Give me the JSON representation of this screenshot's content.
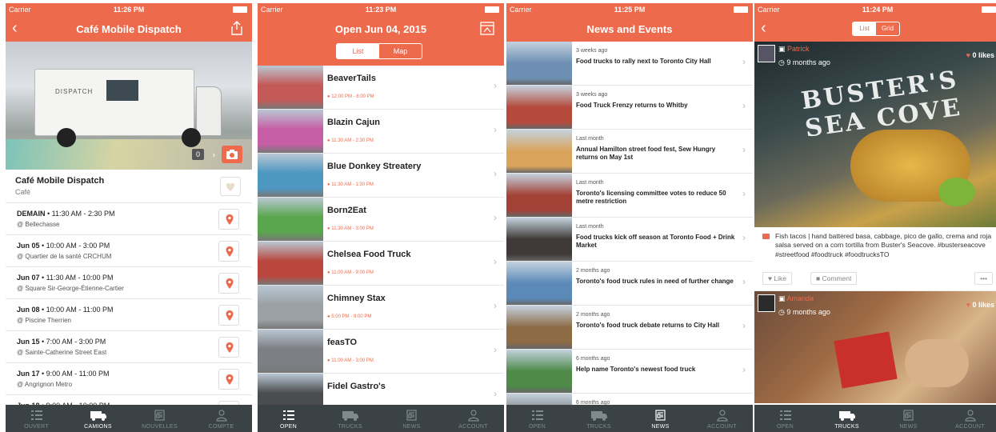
{
  "colors": {
    "accent": "#ee6a4c",
    "tabbar": "#3b4245",
    "tab_inactive": "#7f8a8d",
    "white": "#ffffff"
  },
  "status": {
    "carrier": "Carrier"
  },
  "screen1": {
    "time": "11:26 PM",
    "title": "Café Mobile Dispatch",
    "truck_label": "DISPATCH",
    "photo_count": "0",
    "name": "Café Mobile Dispatch",
    "category": "Café",
    "schedule": [
      {
        "day": "DEMAIN",
        "hours": " • 11:30 AM - 2:30 PM",
        "place": "@ Bellechasse"
      },
      {
        "day": "Jun 05",
        "hours": " • 10:00 AM - 3:00 PM",
        "place": "@ Quartier de la santé CRCHUM"
      },
      {
        "day": "Jun 07",
        "hours": " • 11:30 AM - 10:00 PM",
        "place": "@ Square Sir-George-Étienne-Cartier"
      },
      {
        "day": "Jun 08",
        "hours": " • 10:00 AM - 11:00 PM",
        "place": "@ Piscine Therrien"
      },
      {
        "day": "Jun 15",
        "hours": " • 7:00 AM - 3:00 PM",
        "place": "@ Sainte-Catherine Street East"
      },
      {
        "day": "Jun 17",
        "hours": " • 9:00 AM - 11:00 PM",
        "place": "@ Angrignon Metro"
      },
      {
        "day": "Jun 18",
        "hours": " • 9:00 AM - 10:00 PM",
        "place": ""
      }
    ],
    "tabs": [
      "OUVERT",
      "CAMIONS",
      "NOUVELLES",
      "COMPTE"
    ],
    "active_tab": 1
  },
  "screen2": {
    "time": "11:23 PM",
    "title": "Open Jun 04, 2015",
    "segments": [
      "List",
      "Map"
    ],
    "trucks": [
      {
        "name": "BeaverTails",
        "hours": "12:00 PM - 8:00 PM",
        "thumb": "#c45a57"
      },
      {
        "name": "Blazin Cajun",
        "hours": "11:30 AM - 2:30 PM",
        "thumb": "#c65fa5"
      },
      {
        "name": "Blue Donkey Streatery",
        "hours": "11:30 AM - 1:30 PM",
        "thumb": "#4d97c1"
      },
      {
        "name": "Born2Eat",
        "hours": "11:30 AM - 3:00 PM",
        "thumb": "#5aa64e"
      },
      {
        "name": "Chelsea Food Truck",
        "hours": "11:00 AM - 9:00 PM",
        "thumb": "#b9473e"
      },
      {
        "name": "Chimney Stax",
        "hours": "5:00 PM - 8:00 PM",
        "thumb": "#9aa0a3"
      },
      {
        "name": "feasTO",
        "hours": "11:00 AM - 3:00 PM",
        "thumb": "#7c7f83"
      },
      {
        "name": "Fidel Gastro's",
        "hours": "",
        "thumb": "#4a4c4f"
      }
    ],
    "tabs": [
      "OPEN",
      "TRUCKS",
      "NEWS",
      "ACCOUNT"
    ],
    "active_tab": 0
  },
  "screen3": {
    "time": "11:25 PM",
    "title": "News and Events",
    "news": [
      {
        "ago": "3 weeks ago",
        "headline": "Food trucks to rally next to Toronto City Hall",
        "thumb": "#6d8fb3"
      },
      {
        "ago": "3 weeks ago",
        "headline": "Food Truck Frenzy returns to Whitby",
        "thumb": "#b54a3c"
      },
      {
        "ago": "Last month",
        "headline": "Annual Hamilton street food fest, Sew Hungry returns on May 1st",
        "thumb": "#d9a35b"
      },
      {
        "ago": "Last month",
        "headline": "Toronto's licensing committee votes to reduce 50 metre restriction",
        "thumb": "#a24236"
      },
      {
        "ago": "Last month",
        "headline": "Food trucks kick off season at Toronto Food + Drink Market",
        "thumb": "#3f3a37"
      },
      {
        "ago": "2 months ago",
        "headline": "Toronto's food truck rules in need of further change",
        "thumb": "#5b89b8"
      },
      {
        "ago": "2 months ago",
        "headline": "Toronto's food truck debate returns to City Hall",
        "thumb": "#8c6b45"
      },
      {
        "ago": "6 months ago",
        "headline": "Help name Toronto's newest food truck",
        "thumb": "#4f8a49"
      },
      {
        "ago": "6 months ago",
        "headline": "",
        "thumb": "#777"
      }
    ],
    "tabs": [
      "OPEN",
      "TRUCKS",
      "NEWS",
      "ACCOUNT"
    ],
    "active_tab": 2
  },
  "screen4": {
    "time": "11:24 PM",
    "segments": [
      "List",
      "Grid"
    ],
    "posts": [
      {
        "user": "Patrick",
        "ago": "9 months ago",
        "likes": "0 likes",
        "sign": "BUSTER'S SEA COVE",
        "caption": "Fish tacos | hand battered basa, cabbage, pico de gallo, crema and roja salsa served on a corn tortilla from Buster's Seacove. #busterseacove #streetfood #foodtruck #foodtrucksTO"
      },
      {
        "user": "Amanda",
        "ago": "9 months ago",
        "likes": "0 likes"
      }
    ],
    "like_label": "Like",
    "comment_label": "Comment",
    "more_label": "•••",
    "tabs": [
      "OPEN",
      "TRUCKS",
      "NEWS",
      "ACCOUNT"
    ],
    "active_tab": 1
  },
  "icons": [
    "back-arrow-icon",
    "share-icon",
    "calendar-icon",
    "heart-icon",
    "pin-icon",
    "camera-icon",
    "chevron-right-icon",
    "list-icon",
    "truck-icon",
    "news-icon",
    "account-icon",
    "photo-icon",
    "clock-icon",
    "comment-icon"
  ]
}
